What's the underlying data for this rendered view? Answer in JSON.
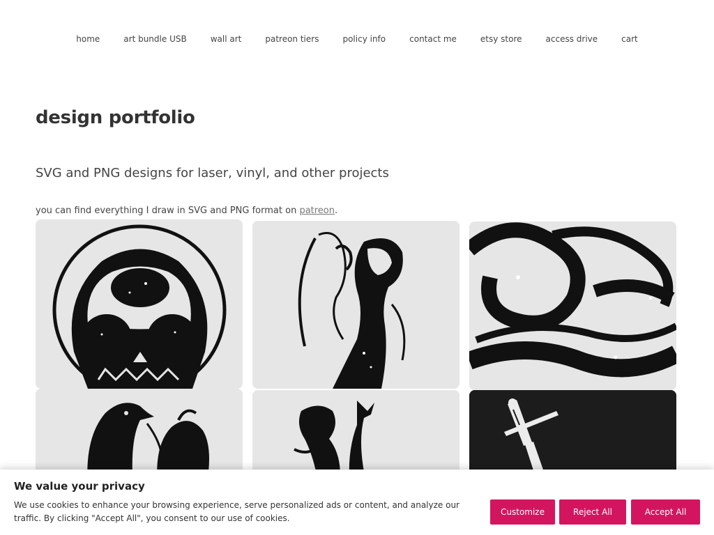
{
  "nav": {
    "items": [
      {
        "label": "home"
      },
      {
        "label": "art bundle USB"
      },
      {
        "label": "wall art"
      },
      {
        "label": "patreon tiers"
      },
      {
        "label": "policy info"
      },
      {
        "label": "contact me"
      },
      {
        "label": "etsy store"
      },
      {
        "label": "access drive"
      },
      {
        "label": "cart"
      }
    ]
  },
  "main": {
    "title": "design portfolio",
    "subtitle": "SVG and PNG designs for laser, vinyl, and other projects",
    "intro_prefix": "you can find everything I draw in SVG and PNG format on ",
    "intro_link": "patreon",
    "intro_suffix": "."
  },
  "gallery": {
    "images": [
      {
        "subject": "skull"
      },
      {
        "subject": "woman-silhouette"
      },
      {
        "subject": "abstract-swirl"
      },
      {
        "subject": "raven"
      },
      {
        "subject": "hooded-figure"
      },
      {
        "subject": "sword"
      }
    ]
  },
  "consent": {
    "title": "We value your privacy",
    "text": "We use cookies to enhance your browsing experience, serve personalized ads or content, and analyze our traffic. By clicking \"Accept All\", you consent to our use of cookies.",
    "customize_label": "Customize",
    "reject_label": "Reject All",
    "accept_label": "Accept All",
    "button_color": "#d3155f"
  }
}
